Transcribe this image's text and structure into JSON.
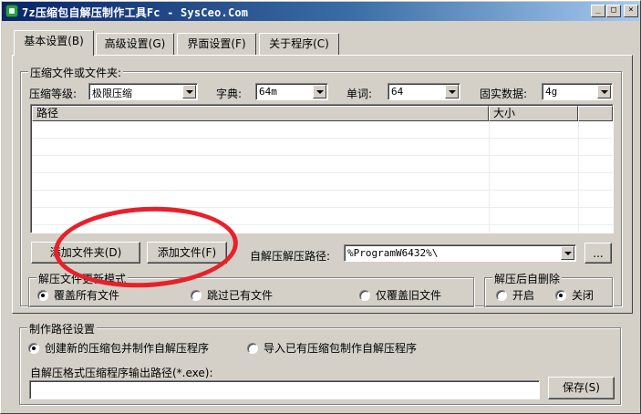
{
  "window": {
    "title": "7z压缩包自解压制作工具Fc - SysCeo.Com",
    "minimize": "_",
    "maximize": "□",
    "close": "×"
  },
  "tabs": [
    {
      "label": "基本设置(B)",
      "active": true
    },
    {
      "label": "高级设置(G)",
      "active": false
    },
    {
      "label": "界面设置(F)",
      "active": false
    },
    {
      "label": "关于程序(C)",
      "active": false
    }
  ],
  "compress": {
    "group_title": "压缩文件或文件夹:",
    "level_label": "压缩等级:",
    "level_value": "极限压缩",
    "dict_label": "字典:",
    "dict_value": "64m",
    "word_label": "单词:",
    "word_value": "64",
    "solid_label": "固实数据:",
    "solid_value": "4g",
    "columns": [
      "路径",
      "大小"
    ],
    "add_folder": "添加文件夹(D)",
    "add_file": "添加文件(F)",
    "extract_path_label": "自解压解压路径:",
    "extract_path_value": "%ProgramW6432%\\",
    "browse": "..."
  },
  "update_mode": {
    "group_title": "解压文件更新模式",
    "options": [
      "覆盖所有文件",
      "跳过已有文件",
      "仅覆盖旧文件"
    ],
    "selected": 0
  },
  "auto_delete": {
    "group_title": "解压后自删除",
    "options": [
      "开启",
      "关闭"
    ],
    "selected": 1
  },
  "build": {
    "group_title": "制作路径设置",
    "options": [
      "创建新的压缩包并制作自解压程序",
      "导入已有压缩包制作自解压程序"
    ],
    "selected": 0,
    "output_label": "自解压格式压缩程序输出路径(*.exe):",
    "output_value": "",
    "save": "保存(S)"
  },
  "colors": {
    "annotation": "#e8202a",
    "titlebar_start": "#0a246a",
    "titlebar_end": "#a6caf0"
  }
}
